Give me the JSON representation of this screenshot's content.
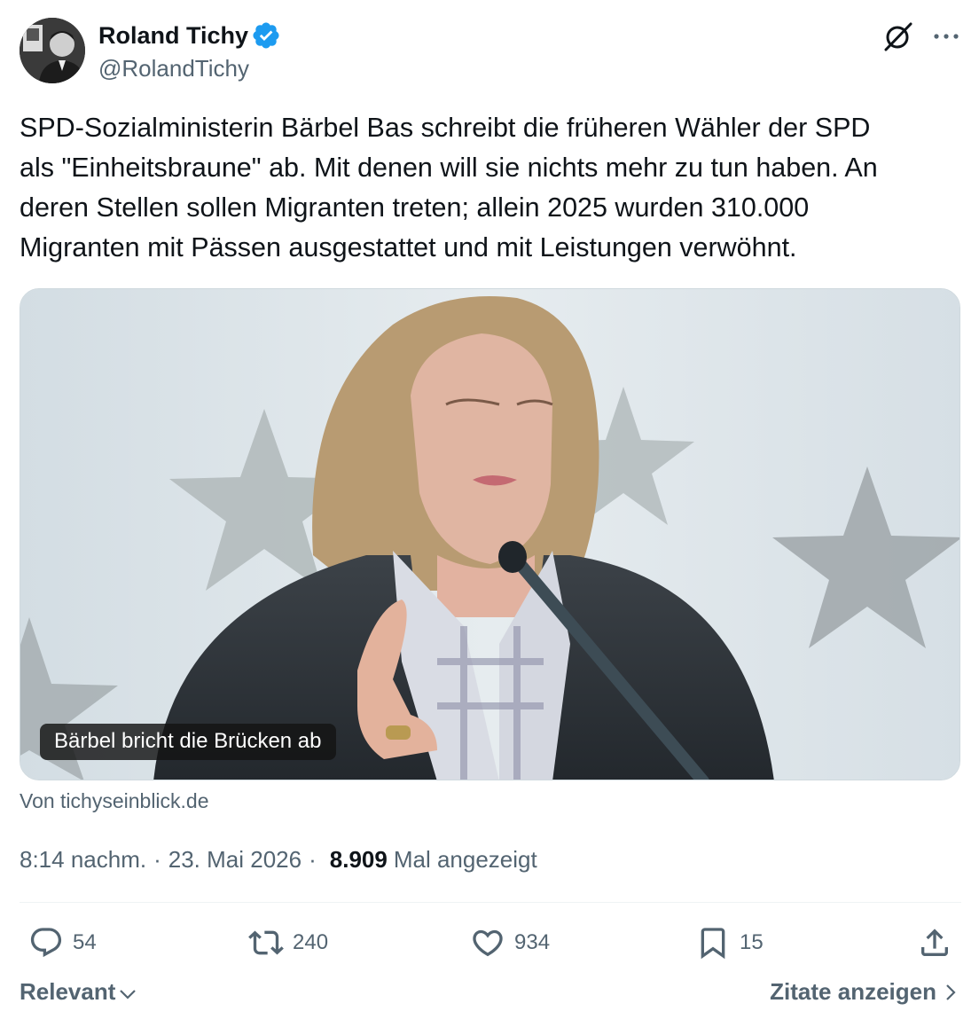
{
  "author": {
    "name": "Roland Tichy",
    "handle": "@RolandTichy"
  },
  "tweet": {
    "text": "SPD-Sozialministerin Bärbel Bas schreibt die früheren Wähler der SPD\nals \"Einheitsbraune\" ab. Mit denen will sie nichts mehr zu tun haben. An\nderen Stellen sollen Migranten treten; allein 2025 wurden 310.000\nMigranten mit Pässen ausgestattet und mit Leistungen verwöhnt.",
    "card_caption": "Bärbel bricht die Brücken ab",
    "card_source": "Von tichyseinblick.de",
    "time": "8:14 nachm.",
    "date": "23. Mai 2026",
    "views": "8.909",
    "views_label": "Mal angezeigt"
  },
  "actions": {
    "replies": "54",
    "reposts": "240",
    "likes": "934",
    "bookmarks": "15"
  },
  "footer": {
    "sort_label": "Relevant",
    "quotes_label": "Zitate anzeigen"
  },
  "colors": {
    "text_primary": "#0f1419",
    "text_secondary": "#536471",
    "verified_blue": "#1d9bf0",
    "divider": "#eff3f4"
  },
  "icons": [
    "verified-badge-icon",
    "grok-icon",
    "more-icon",
    "reply-icon",
    "repost-icon",
    "like-icon",
    "bookmark-icon",
    "share-icon",
    "chevron-down-icon",
    "chevron-right-icon"
  ]
}
